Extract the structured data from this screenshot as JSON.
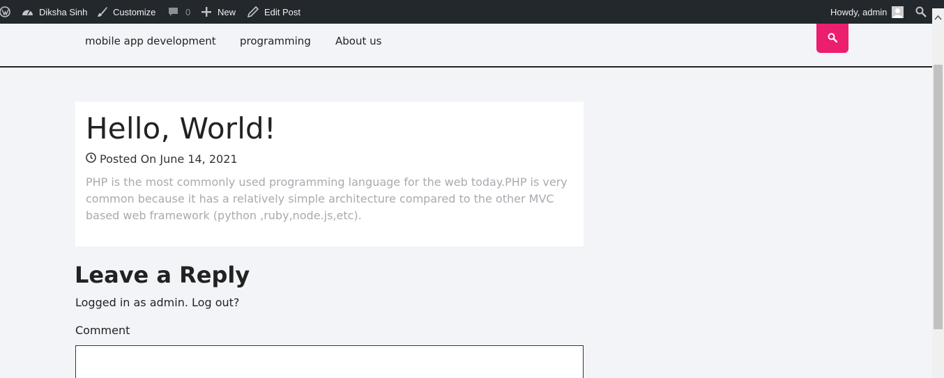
{
  "adminbar": {
    "site_name": "Diksha Sinh",
    "customize": "Customize",
    "comments_count": "0",
    "new_label": "New",
    "edit_post": "Edit Post",
    "howdy": "Howdy, admin"
  },
  "nav": {
    "items": [
      "mobile app development",
      "programming",
      "About us"
    ],
    "search_color": "#ec1e6e"
  },
  "post": {
    "title": "Hello, World!",
    "meta": "Posted On June 14, 2021",
    "excerpt": "PHP is the most commonly used programming language for the web today.PHP  is very common because it has a relatively simple architecture compared to the other MVC based web framework (python ,ruby,node.js,etc)."
  },
  "reply": {
    "title": "Leave a Reply",
    "logged_in": "Logged in as admin. Log out?",
    "comment_label": "Comment",
    "comment_value": ""
  },
  "icons": [
    "wordpress-icon",
    "dashboard-icon",
    "brush-icon",
    "comment-icon",
    "plus-icon",
    "pencil-icon",
    "avatar",
    "search-icon",
    "clock-icon"
  ]
}
